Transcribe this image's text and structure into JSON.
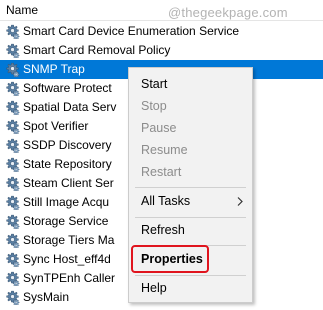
{
  "header": {
    "column_name": "Name",
    "watermark": "@thegeekpage.com"
  },
  "services": [
    {
      "name": "Smart Card Device Enumeration Service",
      "icon": "gear-icon",
      "selected": false
    },
    {
      "name": "Smart Card Removal Policy",
      "icon": "gear-icon",
      "selected": false
    },
    {
      "name": "SNMP Trap",
      "icon": "gear-icon",
      "selected": true
    },
    {
      "name": "Software Protect",
      "icon": "gear-icon",
      "selected": false
    },
    {
      "name": "Spatial Data Serv",
      "icon": "gear-icon",
      "selected": false
    },
    {
      "name": "Spot Verifier",
      "icon": "gear-icon",
      "selected": false
    },
    {
      "name": "SSDP Discovery",
      "icon": "gear-icon",
      "selected": false
    },
    {
      "name": "State Repository",
      "icon": "gear-icon",
      "selected": false
    },
    {
      "name": "Steam Client Ser",
      "icon": "gear-icon",
      "selected": false
    },
    {
      "name": "Still Image Acqu",
      "icon": "gear-icon",
      "selected": false
    },
    {
      "name": "Storage Service",
      "icon": "gear-icon",
      "selected": false
    },
    {
      "name": "Storage Tiers Ma",
      "icon": "gear-icon",
      "selected": false
    },
    {
      "name": "Sync Host_eff4d",
      "icon": "gear-icon",
      "selected": false
    },
    {
      "name": "SynTPEnh Caller",
      "icon": "gear-icon",
      "selected": false
    },
    {
      "name": "SysMain",
      "icon": "gear-icon",
      "selected": false
    }
  ],
  "context_menu": {
    "start": "Start",
    "stop": "Stop",
    "pause": "Pause",
    "resume": "Resume",
    "restart": "Restart",
    "all_tasks": "All Tasks",
    "refresh": "Refresh",
    "properties": "Properties",
    "help": "Help"
  },
  "colors": {
    "selection": "#0078d7",
    "highlight_box": "#e0141e",
    "disabled_text": "#8c8c8c",
    "menu_background": "#f2f2f2"
  }
}
